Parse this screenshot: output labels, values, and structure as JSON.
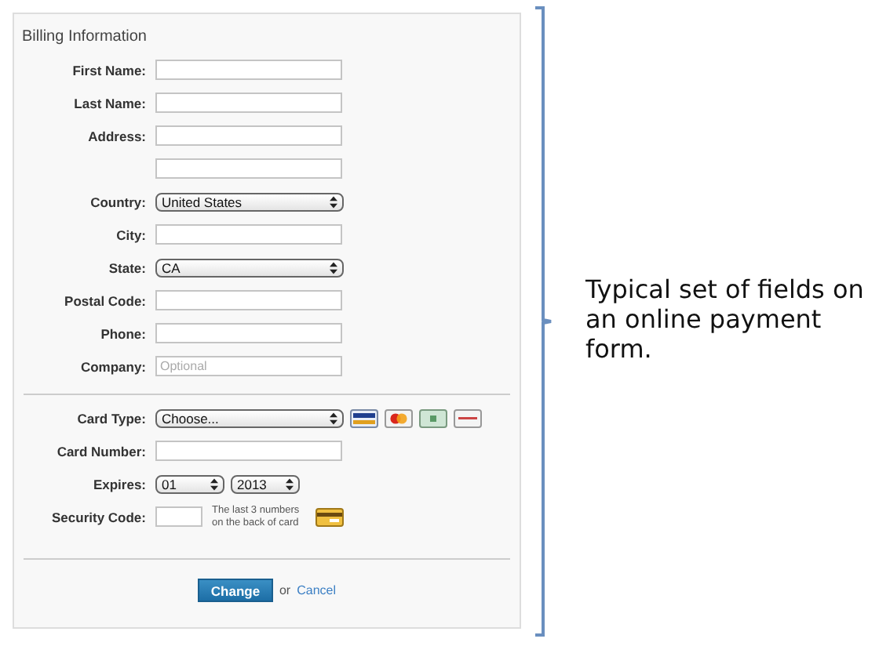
{
  "panel": {
    "title": "Billing Information"
  },
  "billing_fields": [
    {
      "kind": "text",
      "label": "First Name:"
    },
    {
      "kind": "text",
      "label": "Last Name:"
    },
    {
      "kind": "text",
      "label": "Address:"
    },
    {
      "kind": "text"
    },
    {
      "kind": "select",
      "label": "Country:",
      "value": "United States"
    },
    {
      "kind": "text",
      "label": "City:"
    },
    {
      "kind": "select",
      "label": "State:",
      "value": "CA"
    },
    {
      "kind": "text",
      "label": "Postal Code:"
    },
    {
      "kind": "text",
      "label": "Phone:"
    },
    {
      "kind": "text",
      "label": "Company:",
      "placeholder": "Optional"
    }
  ],
  "payment_fields": [
    {
      "kind": "card_select",
      "label": "Card Type:",
      "value": "Choose..."
    },
    {
      "kind": "text",
      "label": "Card Number:"
    },
    {
      "kind": "expiry",
      "label": "Expires:",
      "month": "01",
      "year": "2013"
    },
    {
      "kind": "security",
      "label": "Security Code:",
      "hint": "The last 3 numbers on the back of card"
    }
  ],
  "actions": {
    "submit": "Change",
    "separator": "or",
    "cancel": "Cancel"
  },
  "annotation": {
    "text": "Typical set of fields on an online payment form."
  }
}
